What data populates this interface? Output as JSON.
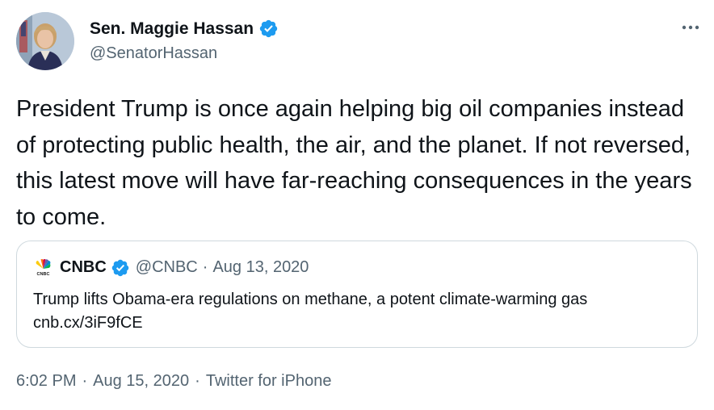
{
  "author": {
    "display_name": "Sen. Maggie Hassan",
    "handle": "@SenatorHassan",
    "avatar_icon": "avatar-photo",
    "verified_icon": "verified-badge-icon"
  },
  "tweet": {
    "text": "President Trump is once again helping big oil companies instead of protecting public health, the air, and the planet. If not reversed, this latest move will have far-reaching consequences in the years to come."
  },
  "quoted_tweet": {
    "display_name": "CNBC",
    "handle": "@CNBC",
    "separator": "·",
    "date": "Aug 13, 2020",
    "text": "Trump lifts Obama-era regulations on methane, a potent climate-warming gas cnb.cx/3iF9fCE",
    "logo_icon": "cnbc-peacock-logo"
  },
  "meta": {
    "time": "6:02 PM",
    "separator": "·",
    "date": "Aug 15, 2020",
    "source": "Twitter for iPhone"
  },
  "colors": {
    "verified": "#1d9bf0",
    "text": "#0f1419",
    "secondary": "#536471",
    "border": "#cfd9de"
  }
}
